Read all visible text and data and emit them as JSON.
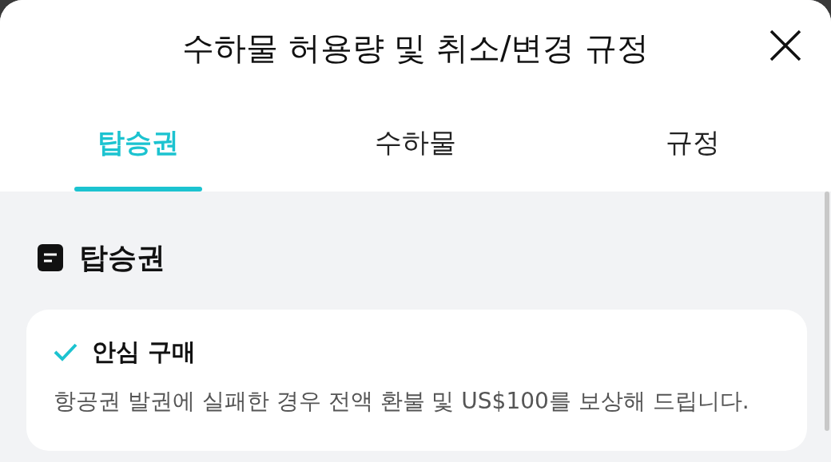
{
  "header": {
    "title": "수하물 허용량 및 취소/변경 규정"
  },
  "tabs": [
    {
      "label": "탑승권",
      "selected": true
    },
    {
      "label": "수하물",
      "selected": false
    },
    {
      "label": "규정",
      "selected": false
    }
  ],
  "section": {
    "title": "탑승권"
  },
  "card": {
    "title": "안심 구매",
    "body": "항공권 발권에 실패한 경우 전액 환불 및 US$100를 보상해 드립니다."
  }
}
